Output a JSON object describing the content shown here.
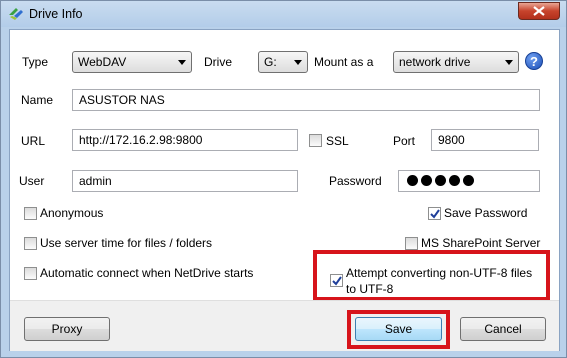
{
  "window": {
    "title": "Drive Info"
  },
  "type": {
    "label": "Type",
    "value": "WebDAV"
  },
  "drive": {
    "label": "Drive",
    "value": "G:"
  },
  "mount": {
    "label": "Mount as a",
    "value": "network drive"
  },
  "name": {
    "label": "Name",
    "value": "ASUSTOR NAS"
  },
  "url": {
    "label": "URL",
    "value": "http://172.16.2.98:9800"
  },
  "ssl": {
    "label": "SSL",
    "checked": false
  },
  "port": {
    "label": "Port",
    "value": "9800"
  },
  "user": {
    "label": "User",
    "value": "admin"
  },
  "password": {
    "label": "Password",
    "masked_length": 5
  },
  "options": {
    "anonymous": {
      "label": "Anonymous",
      "checked": false
    },
    "save_password": {
      "label": "Save Password",
      "checked": true
    },
    "server_time": {
      "label": "Use server time for files / folders",
      "checked": false
    },
    "sharepoint": {
      "label": "MS SharePoint Server",
      "checked": false
    },
    "auto_connect": {
      "label": "Automatic connect when NetDrive starts",
      "checked": false
    },
    "utf8": {
      "label_line1": "Attempt converting non-UTF-8 files",
      "label_line2": "to UTF-8",
      "checked": true
    }
  },
  "buttons": {
    "proxy": "Proxy",
    "save": "Save",
    "cancel": "Cancel"
  },
  "colors": {
    "highlight": "#d7141b",
    "titlebar": "#b9d1ea",
    "close": "#c7432c"
  }
}
